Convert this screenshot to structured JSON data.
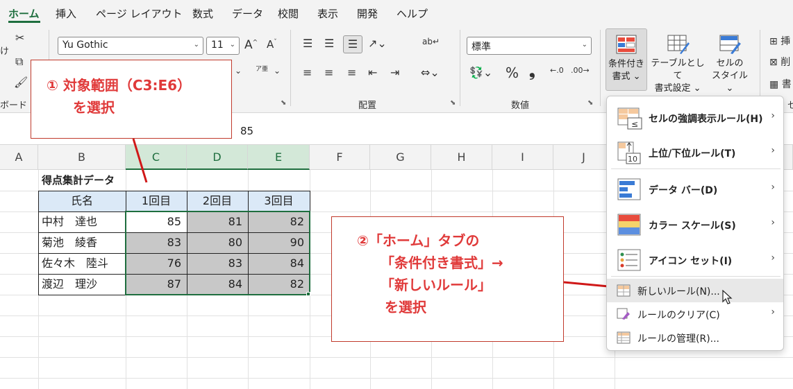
{
  "tabs": [
    "ホーム",
    "挿入",
    "ページ レイアウト",
    "数式",
    "データ",
    "校閲",
    "表示",
    "開発",
    "ヘルプ"
  ],
  "ribbon": {
    "clipboard_label": "ボード",
    "clipboard_partial": "け",
    "font_name": "Yu Gothic",
    "font_size": "11",
    "phonetic_glyph": "ア亜",
    "alignment_label": "配置",
    "number_format": "標準",
    "number_label": "数値",
    "percent_glyph": "%",
    "comma_glyph": "❟",
    "cond_format_label": [
      "条件付き",
      "書式 ⌄"
    ],
    "table_format_label": [
      "テーブルとして",
      "書式設定 ⌄"
    ],
    "cell_style_label": [
      "セルの",
      "スタイル ⌄"
    ],
    "right_partial": [
      "挿",
      "削",
      "書"
    ],
    "right_group_partial": "セ"
  },
  "formula_bar": {
    "value": "85"
  },
  "grid": {
    "columns": [
      "A",
      "B",
      "C",
      "D",
      "E",
      "F",
      "G",
      "H",
      "I",
      "J"
    ],
    "title": "得点集計データ",
    "headers": [
      "氏名",
      "1回目",
      "2回目",
      "3回目"
    ],
    "rows": [
      {
        "name": "中村　達也",
        "scores": [
          "85",
          "81",
          "82"
        ]
      },
      {
        "name": "菊池　綾香",
        "scores": [
          "83",
          "80",
          "90"
        ]
      },
      {
        "name": "佐々木　陸斗",
        "scores": [
          "76",
          "83",
          "84"
        ]
      },
      {
        "name": "渡辺　理沙",
        "scores": [
          "87",
          "84",
          "82"
        ]
      }
    ]
  },
  "callout1": {
    "line1": "① 対象範囲（C3:E6）",
    "line2": "を選択"
  },
  "callout2": {
    "line1": "②「ホーム」タブの",
    "line2": "「条件付き書式」→",
    "line3": "「新しいルール」",
    "line4": "を選択"
  },
  "menu": {
    "items": [
      {
        "label": "セルの強調表示ルール(H)",
        "has_submenu": true
      },
      {
        "label": "上位/下位ルール(T)",
        "has_submenu": true
      },
      {
        "label": "データ バー(D)",
        "has_submenu": true
      },
      {
        "label": "カラー スケール(S)",
        "has_submenu": true
      },
      {
        "label": "アイコン セット(I)",
        "has_submenu": true
      },
      {
        "label": "新しいルール(N)...",
        "has_submenu": false
      },
      {
        "label": "ルールのクリア(C)",
        "has_submenu": true
      },
      {
        "label": "ルールの管理(R)...",
        "has_submenu": false
      }
    ],
    "submenu_arrow": "›"
  },
  "colors": {
    "accent": "#1e6e3e",
    "callout_red": "#e03a3a",
    "selected_fill": "#c8c8c8",
    "header_fill": "#dbe9f7"
  }
}
